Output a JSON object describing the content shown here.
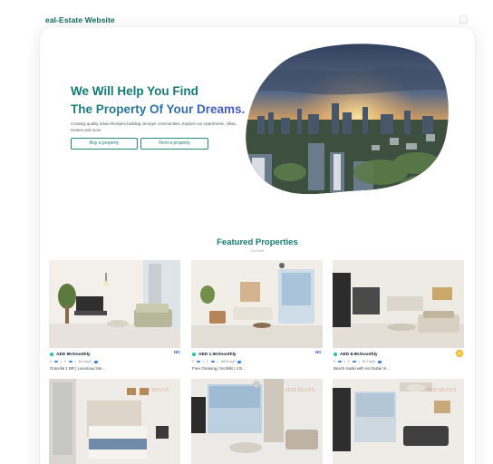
{
  "window": {
    "title": "eal-Estate Website"
  },
  "hero": {
    "title_line1": "We Will Help You Find",
    "title_line2": "The Property Of Your Dreams.",
    "description": "Creating quality urban lifestyles,building stronger communities. Explore our Apartments, Villas, Homes and more",
    "buy_label": "Buy a property",
    "rent_label": "Rent a property"
  },
  "featured": {
    "title": "Featured Properties",
    "subtitle": "For Rent",
    "properties": [
      {
        "price": "AED 9K/monthly",
        "beds": "2",
        "baths": "2",
        "size": "81.3 sq.ft",
        "title": "Graceful 1 BR | Luxurious Inte...",
        "badge": "HO"
      },
      {
        "price": "AED 1.5K/monthly",
        "beds": "2",
        "baths": "2",
        "size": "420.8 sq.ft",
        "title": "Free Cleaning | No Bills | 2 B...",
        "badge": "HO"
      },
      {
        "price": "AED 8.9K/monthly",
        "beds": "0",
        "baths": "1",
        "size": "51.1 sq.ft",
        "title": "Beach studio with Ain Dubai Vi...",
        "badge": ""
      },
      {
        "price": "",
        "beds": "",
        "baths": "",
        "size": "",
        "title": "",
        "watermark": "HOLIDAYS"
      },
      {
        "price": "",
        "beds": "",
        "baths": "",
        "size": "",
        "title": "",
        "watermark": "HOLIDAYS"
      },
      {
        "price": "",
        "beds": "",
        "baths": "",
        "size": "",
        "title": "",
        "watermark": "HOLIDAYS"
      }
    ]
  },
  "colors": {
    "accent": "#127a74",
    "blue": "#2b6fb2",
    "green_dot": "#22c3a5"
  }
}
